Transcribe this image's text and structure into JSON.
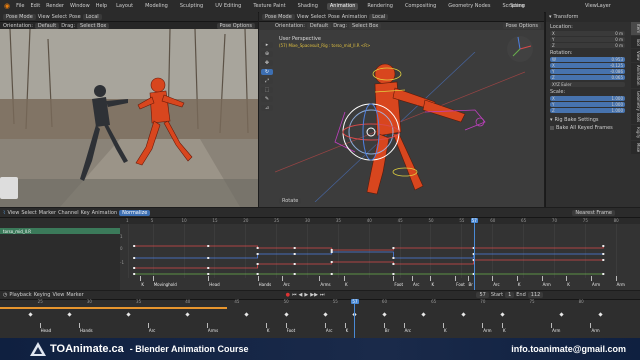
{
  "topbar": {
    "menus": [
      "File",
      "Edit",
      "Render",
      "Window",
      "Help"
    ],
    "workspaces": [
      "Layout",
      "Modeling",
      "Sculpting",
      "UV Editing",
      "Texture Paint",
      "Shading",
      "Animation",
      "Rendering",
      "Compositing",
      "Geometry Nodes",
      "Scripting"
    ],
    "active_workspace": "Animation",
    "scene": "Scene",
    "view_layer": "ViewLayer"
  },
  "left_view": {
    "mode": "Pose Mode",
    "menus": [
      "View",
      "Select",
      "Pose"
    ],
    "orientation_label": "Orientation:",
    "orientation": "Default",
    "drag_label": "Drag:",
    "drag": "Select Box",
    "pivot": "Local",
    "pose_options": "Pose Options"
  },
  "right_view": {
    "mode": "Pose Mode",
    "menus": [
      "View",
      "Select",
      "Pose",
      "Animation"
    ],
    "orientation_label": "Orientation:",
    "orientation": "Default",
    "drag_label": "Drag:",
    "drag": "Select Box",
    "pivot": "Local",
    "pose_options": "Pose Options",
    "perspective": "User Perspective",
    "object_info": "(57) Mixe_Spacesuit_Rig : torso_mid_ll.R <R>",
    "footer_label": "Rotate"
  },
  "sidebar": {
    "header": "Transform",
    "location_label": "Location:",
    "location": [
      "0 m",
      "0 m",
      "0 m"
    ],
    "rotation_label": "Rotation:",
    "rotation": [
      "0.953",
      "-0.125",
      "-0.086",
      "0.065"
    ],
    "rotation_mode": "XYZ Euler",
    "scale_label": "Scale:",
    "scale": [
      "1.000",
      "1.000",
      "1.000"
    ],
    "axes": [
      "X",
      "Y",
      "Z",
      "W"
    ],
    "bake_settings": "Rig Bake Settings",
    "bake_all": "Bake All Keyed Frames",
    "tabs": [
      "Item",
      "Tool",
      "View",
      "Animation",
      "Geometry Tools",
      "Rigify",
      "Mixe"
    ]
  },
  "graph_editor": {
    "menus": [
      "View",
      "Select",
      "Marker",
      "Channel",
      "Key",
      "Animation"
    ],
    "normalize": "Normalize",
    "snap": "Nearest Frame",
    "channel": "torso_mid_ll.R",
    "frame_ticks": [
      "1",
      "5",
      "10",
      "15",
      "20",
      "25",
      "30",
      "35",
      "40",
      "45",
      "50",
      "55",
      "57",
      "60",
      "65",
      "70",
      "75",
      "80"
    ],
    "value_ticks": [
      "1",
      "0",
      "-1"
    ],
    "current_frame": "57",
    "markers": [
      "K",
      "Movinghold",
      "Head",
      "Hands",
      "Arc",
      "Arms",
      "K",
      "Foot",
      "Arc",
      "K",
      "Foot",
      "Br",
      "Arc",
      "K",
      "Arm",
      "K",
      "Arm",
      "Arm"
    ]
  },
  "timeline": {
    "menus": [
      "Playback",
      "Keying",
      "View",
      "Marker"
    ],
    "current_frame": "57",
    "start_label": "Start",
    "start": "1",
    "end_label": "End",
    "end": "112",
    "frame_ticks": [
      "25",
      "30",
      "35",
      "40",
      "45",
      "50",
      "55",
      "57",
      "60",
      "65",
      "70",
      "75",
      "80"
    ],
    "markers": [
      "Head",
      "Hands",
      "Arc",
      "Arms",
      "K",
      "Foot",
      "Arc",
      "K",
      "Br",
      "Arc",
      "K",
      "Arm",
      "K",
      "Arm",
      "Arm"
    ]
  },
  "banner": {
    "brand": "TOAnimate.ca",
    "course": "- Blender Animation Course",
    "email": "info.toanimate@gmail.com"
  },
  "colors": {
    "accent_blue": "#4a8ad6",
    "red_curve": "#d84a4a",
    "blue_curve": "#4d7fe0",
    "banner_bg": "#1a2a4a",
    "suit_orange": "#d8461e"
  }
}
